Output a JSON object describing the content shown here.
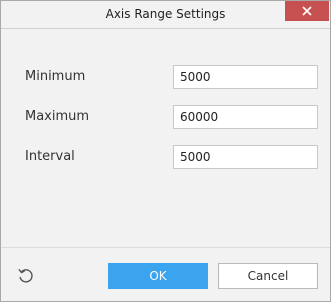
{
  "dialog": {
    "title": "Axis Range Settings",
    "close_icon": "close-icon"
  },
  "fields": [
    {
      "label": "Minimum",
      "value": "5000"
    },
    {
      "label": "Maximum",
      "value": "60000"
    },
    {
      "label": "Interval",
      "value": "5000"
    }
  ],
  "footer": {
    "reset_icon": "reset-icon",
    "ok_label": "OK",
    "cancel_label": "Cancel"
  },
  "colors": {
    "accent": "#3ba4ef",
    "close": "#c75050",
    "background": "#f2f2f2"
  }
}
